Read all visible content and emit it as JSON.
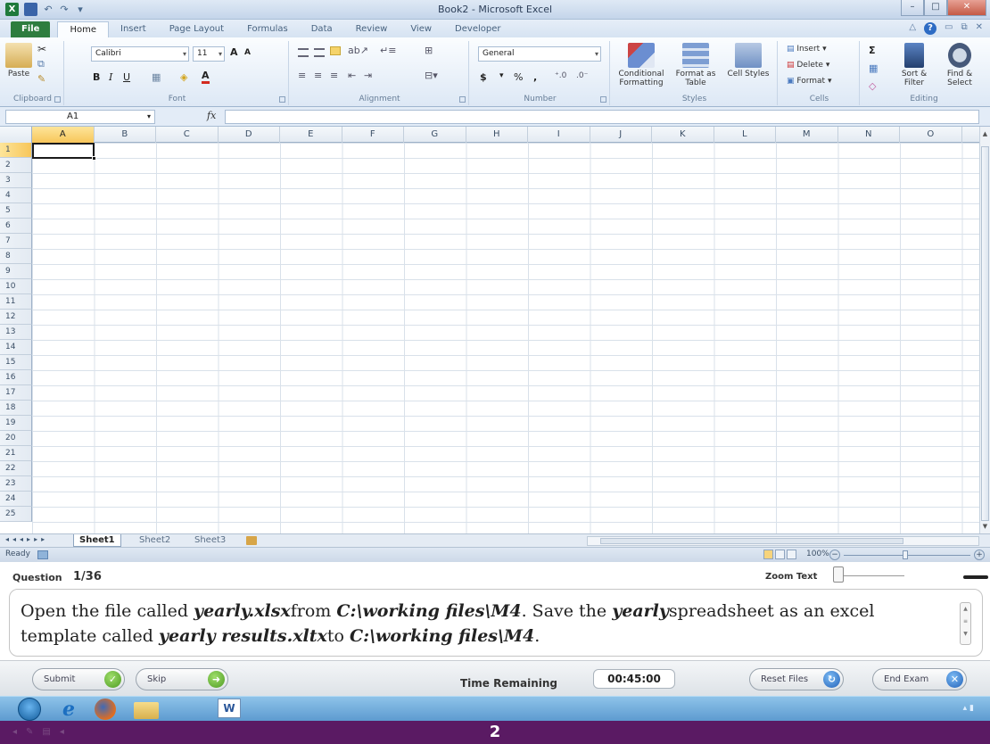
{
  "window": {
    "title": "Book2 - Microsoft Excel"
  },
  "ribbon_tabs": [
    "File",
    "Home",
    "Insert",
    "Page Layout",
    "Formulas",
    "Data",
    "Review",
    "View",
    "Developer"
  ],
  "ribbon": {
    "clipboard": {
      "paste": "Paste",
      "label": "Clipboard"
    },
    "font": {
      "name": "Calibri",
      "size": "11",
      "label": "Font",
      "bold": "B",
      "italic": "I",
      "underline": "U"
    },
    "alignment": {
      "label": "Alignment"
    },
    "number": {
      "format": "General",
      "currency": "$",
      "percent": "%",
      "comma": ",",
      "label": "Number"
    },
    "styles": {
      "conditional": "Conditional Formatting",
      "format_table": "Format as Table",
      "cell_styles": "Cell Styles",
      "label": "Styles"
    },
    "cells": {
      "insert": "Insert",
      "delete": "Delete",
      "format": "Format",
      "label": "Cells"
    },
    "editing": {
      "sort": "Sort & Filter",
      "find": "Find & Select",
      "label": "Editing",
      "sum": "Σ"
    }
  },
  "formula_bar": {
    "name_box": "A1",
    "fx": "fx",
    "value": ""
  },
  "grid": {
    "columns": [
      "A",
      "B",
      "C",
      "D",
      "E",
      "F",
      "G",
      "H",
      "I",
      "J",
      "K",
      "L",
      "M",
      "N",
      "O"
    ],
    "rows": [
      "1",
      "2",
      "3",
      "4",
      "5",
      "6",
      "7",
      "8",
      "9",
      "10",
      "11",
      "12",
      "13",
      "14",
      "15",
      "16",
      "17",
      "18",
      "19",
      "20",
      "21",
      "22",
      "23",
      "24",
      "25"
    ],
    "active_cell": "A1"
  },
  "sheet_tabs": [
    "Sheet1",
    "Sheet2",
    "Sheet3"
  ],
  "status": {
    "ready": "Ready",
    "zoom": "100%"
  },
  "exam": {
    "question_label": "Question",
    "question_number": "1/36",
    "zoom_text_label": "Zoom Text",
    "question": {
      "p1": "Open the file  called ",
      "e1": "yearly.xlsx",
      "p2": "from ",
      "e2": "C:\\working files\\M4",
      "p3": ". Save the ",
      "e3": "yearly",
      "p4": "spreadsheet as an excel template called ",
      "e4": "yearly results.xltx",
      "p5": "to ",
      "e5": "C:\\working files\\M4",
      "p6": "."
    },
    "buttons": {
      "submit": "Submit",
      "skip": "Skip",
      "reset": "Reset Files",
      "end": "End Exam"
    },
    "time_label": "Time Remaining",
    "time_value": "00:45:00"
  },
  "taskbar": {
    "word_label": "W"
  },
  "slide": {
    "page_number": "2"
  }
}
